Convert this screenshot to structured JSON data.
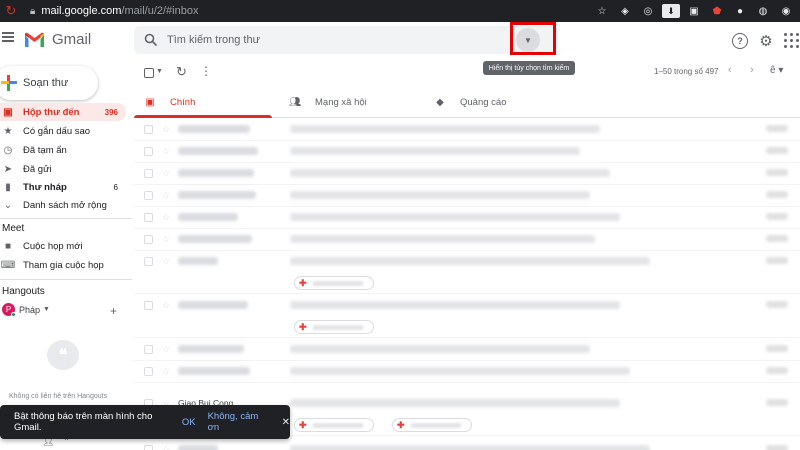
{
  "browser": {
    "url_host": "mail.google.com",
    "url_path": "/mail/u/2/#inbox"
  },
  "app": {
    "name": "Gmail"
  },
  "search": {
    "placeholder": "Tìm kiếm trong thư",
    "tooltip": "Hiển thị tùy chọn tìm kiếm"
  },
  "colors": {
    "accent": "#d93025",
    "highlight": "#e60000"
  },
  "sidebar": {
    "compose": "Soạn thư",
    "items": [
      {
        "label": "Hộp thư đến",
        "count": "396",
        "icon": "inbox-icon",
        "active": true
      },
      {
        "label": "Có gắn dấu sao",
        "icon": "star-icon"
      },
      {
        "label": "Đã tạm ẩn",
        "icon": "clock-icon"
      },
      {
        "label": "Đã gửi",
        "icon": "send-icon"
      },
      {
        "label": "Thư nháp",
        "count": "6",
        "icon": "draft-icon",
        "bold": true
      },
      {
        "label": "Danh sách mở rộng",
        "icon": "chevron-down-icon"
      }
    ],
    "meet": {
      "title": "Meet",
      "items": [
        {
          "label": "Cuộc họp mới",
          "icon": "video-icon"
        },
        {
          "label": "Tham gia cuộc họp",
          "icon": "keyboard-icon"
        }
      ]
    },
    "hangouts": {
      "title": "Hangouts",
      "user": "Pháp",
      "avatar_letter": "P",
      "empty_text": "Không có liên hệ trên Hangouts"
    }
  },
  "toolbar": {
    "pagination": "1–50 trong số 497"
  },
  "tabs": [
    {
      "label": "Chính",
      "icon": "inbox-icon",
      "active": true
    },
    {
      "label": "Mạng xã hội",
      "icon": "people-icon"
    },
    {
      "label": "Quảng cáo",
      "icon": "tag-icon"
    }
  ],
  "emails": {
    "visible_sender": "Giao Bui Cong"
  },
  "snackbar": {
    "message": "Bật thông báo trên màn hình cho Gmail.",
    "ok": "OK",
    "decline": "Không, cảm ơn",
    "close": "✕"
  }
}
